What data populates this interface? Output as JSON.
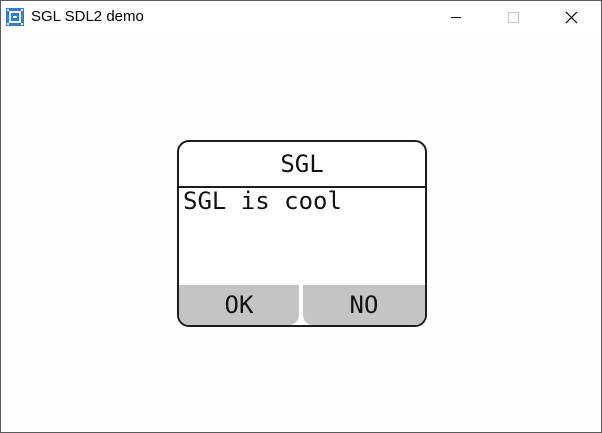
{
  "window": {
    "title": "SGL SDL2 demo",
    "icon": "app-chip-icon",
    "controls": [
      "minimize-icon",
      "maximize-icon",
      "close-icon"
    ]
  },
  "msgbox": {
    "title": "SGL",
    "text": "SGL is cool",
    "buttons": {
      "ok_label": "OK",
      "no_label": "NO"
    }
  },
  "colors": {
    "border": "#1c1c1c",
    "button_bg": "#c4c4c4",
    "window_bg": "#fdfdfd",
    "icon_accent": "#2d7fd6"
  }
}
